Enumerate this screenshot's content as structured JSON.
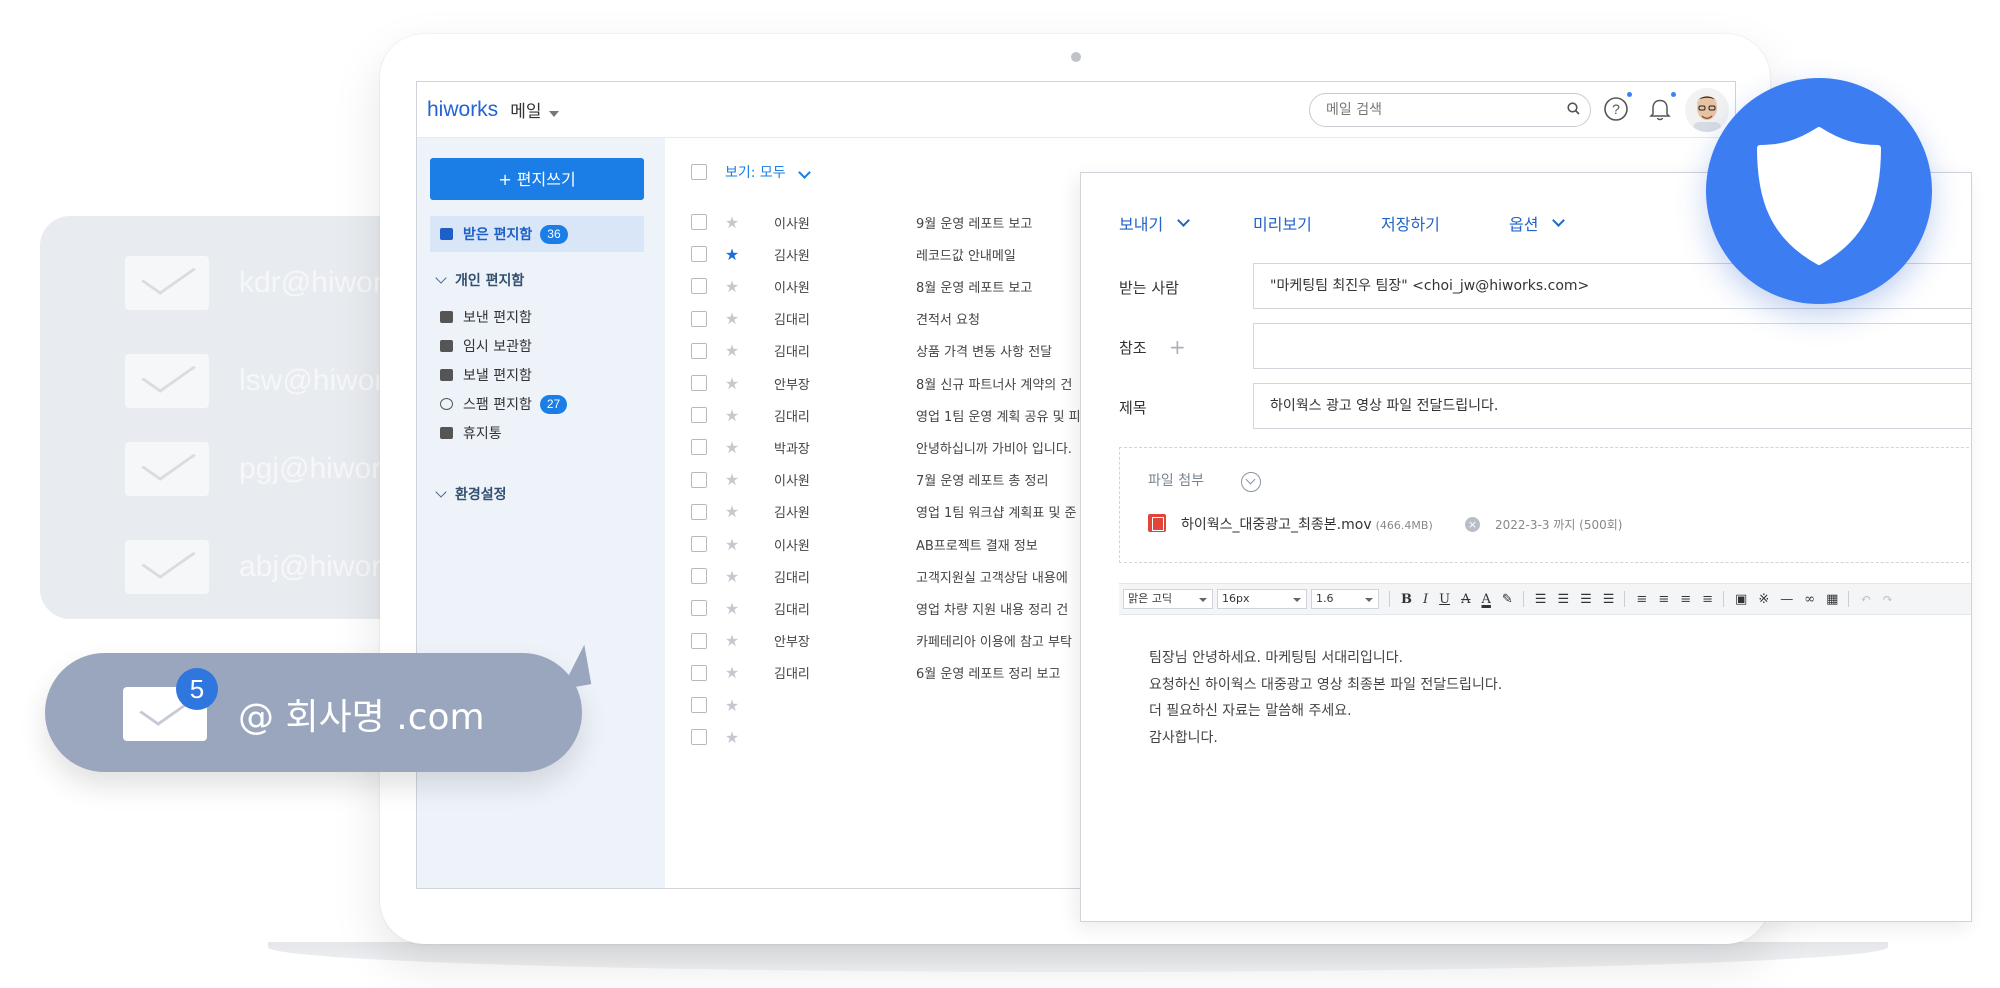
{
  "left_panel": {
    "addresses": [
      "kdr@hiworks",
      "lsw@hiworks",
      "pgj@hiworks",
      "abj@hiworks"
    ],
    "bubble": {
      "count": "5",
      "domain": "@ 회사명 .com"
    }
  },
  "app": {
    "logo": "hiworks",
    "name": "메일",
    "search_placeholder": "메일 검색"
  },
  "sidebar": {
    "compose_label": "+ 편지쓰기",
    "inbox": {
      "label": "받은 편지함",
      "count": "36"
    },
    "personal_group": "개인 편지함",
    "items": [
      {
        "label": "보낸 편지함"
      },
      {
        "label": "임시 보관함"
      },
      {
        "label": "보낼 편지함"
      },
      {
        "label": "스팸 편지함",
        "count": "27"
      },
      {
        "label": "휴지통"
      }
    ],
    "settings_group": "환경설정"
  },
  "list": {
    "view_filter": "보기: 모두",
    "rows": [
      {
        "sender": "이사원",
        "subject": "9월 운영 레포트 보고",
        "starred": false
      },
      {
        "sender": "김사원",
        "subject": "레코드값 안내메일",
        "starred": true
      },
      {
        "sender": "이사원",
        "subject": "8월 운영 레포트 보고",
        "starred": false
      },
      {
        "sender": "김대리",
        "subject": "견적서 요청",
        "starred": false
      },
      {
        "sender": "김대리",
        "subject": "상품 가격 변동 사항 전달",
        "starred": false
      },
      {
        "sender": "안부장",
        "subject": "8월 신규 파트너사 계약의 건",
        "starred": false
      },
      {
        "sender": "김대리",
        "subject": "영업 1팀 운영 계획 공유 및 피",
        "starred": false
      },
      {
        "sender": "박과장",
        "subject": "안녕하십니까 가비아 입니다.",
        "starred": false
      },
      {
        "sender": "이사원",
        "subject": "7월 운영 레포트 총 정리",
        "starred": false
      },
      {
        "sender": "김사원",
        "subject": "영업 1팀 워크샵 계획표 및 준",
        "starred": false
      },
      {
        "sender": "이사원",
        "subject": "AB프로젝트 결재 정보",
        "starred": false
      },
      {
        "sender": "김대리",
        "subject": "고객지원실 고객상담 내용에",
        "starred": false
      },
      {
        "sender": "김대리",
        "subject": "영업 차량 지원 내용 정리 건",
        "starred": false
      },
      {
        "sender": "안부장",
        "subject": "카페테리아 이용에 참고 부탁",
        "starred": false
      },
      {
        "sender": "김대리",
        "subject": "6월 운영 레포트 정리 보고",
        "starred": false
      },
      {
        "sender": "",
        "subject": "",
        "starred": false
      },
      {
        "sender": "",
        "subject": "",
        "starred": false
      }
    ]
  },
  "composer": {
    "toolbar": {
      "send": "보내기",
      "preview": "미리보기",
      "save": "저장하기",
      "options": "옵션"
    },
    "to_label": "받는 사람",
    "to_value": "\"마케팅팀 최진우 팀장\" <choi_jw@hiworks.com>",
    "cc_label": "참조",
    "cc_value": "",
    "subject_label": "제목",
    "subject_value": "하이웍스 광고 영상 파일 전달드립니다.",
    "attachment": {
      "title": "파일 첨부",
      "file_name": "하이웍스_대중광고_최종본.mov",
      "file_size": "(466.4MB)",
      "expiry": "2022-3-3 까지 (500회)"
    },
    "editor": {
      "font": "맑은 고딕",
      "size": "16px",
      "line_height": "1.6"
    },
    "body_lines": [
      "팀장님 안녕하세요. 마케팅팀 서대리입니다.",
      "요청하신 하이웍스 대중광고 영상 최종본 파일 전달드립니다.",
      "더 필요하신 자료는 말씀해 주세요.",
      "감사합니다."
    ]
  },
  "colors": {
    "brand_blue": "#1b7de6",
    "shield_blue": "#3c7ef2",
    "bubble": "#9aa6bd"
  }
}
